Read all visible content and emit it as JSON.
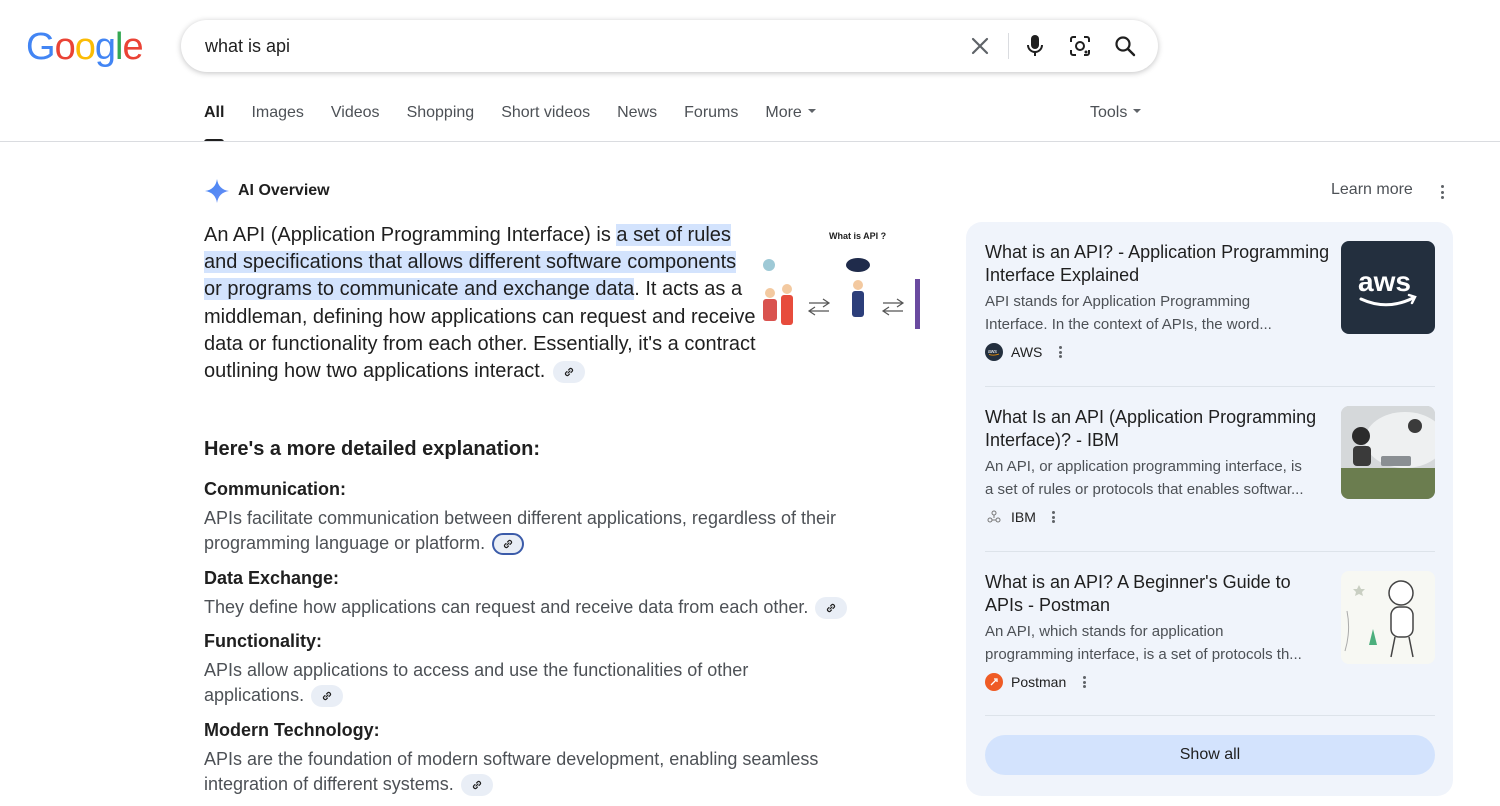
{
  "logo": {
    "text": "Google"
  },
  "search": {
    "query": "what is api",
    "icons": [
      "close-icon",
      "mic-icon",
      "lens-icon",
      "search-icon"
    ]
  },
  "tabs": [
    {
      "label": "All",
      "active": true
    },
    {
      "label": "Images"
    },
    {
      "label": "Videos"
    },
    {
      "label": "Shopping"
    },
    {
      "label": "Short videos"
    },
    {
      "label": "News"
    },
    {
      "label": "Forums"
    },
    {
      "label": "More",
      "has_caret": true
    }
  ],
  "tools": {
    "label": "Tools"
  },
  "ai_overview": {
    "label": "AI Overview",
    "learn_more": "Learn more",
    "lead_pre": "An API (Application Programming Interface) is ",
    "lead_highlight": "a set of rules and specifications that allows different software components or programs to communicate and exchange data",
    "lead_post": ". It acts as a middleman, defining how applications can request and receive data or functionality from each other. Essentially, it's a contract outlining how two applications interact.",
    "image_caption": "What is API ?",
    "subheading": "Here's a more detailed explanation:",
    "items": [
      {
        "title": "Communication:",
        "body": "APIs facilitate communication between different applications, regardless of their programming language or platform."
      },
      {
        "title": "Data Exchange:",
        "body": "They define how applications can request and receive data from each other."
      },
      {
        "title": "Functionality:",
        "body": "APIs allow applications to access and use the functionalities of other applications."
      },
      {
        "title": "Modern Technology:",
        "body": "APIs are the foundation of modern software development, enabling seamless integration of different systems."
      }
    ]
  },
  "sources": {
    "cards": [
      {
        "title": "What is an API? - Application Programming Interface Explained",
        "snippet_1": "API stands for Application Programming",
        "snippet_2": "Interface. In the context of APIs, the word...",
        "source": "AWS",
        "thumb_text": "aws"
      },
      {
        "title": "What Is an API (Application Programming Interface)? - IBM",
        "snippet_1": "An API, or application programming interface, is",
        "snippet_2": "a set of rules or protocols that enables softwar...",
        "source": "IBM"
      },
      {
        "title": "What is an API? A Beginner's Guide to APIs - Postman",
        "snippet_1": "An API, which stands for application",
        "snippet_2": "programming interface, is a set of protocols th...",
        "source": "Postman"
      }
    ],
    "show_all": "Show all"
  },
  "colors": {
    "accent_highlight": "#d3e3fd",
    "panel_bg": "#f0f4fb",
    "aws_dark": "#232f3e",
    "postman_orange": "#ef5b25"
  }
}
